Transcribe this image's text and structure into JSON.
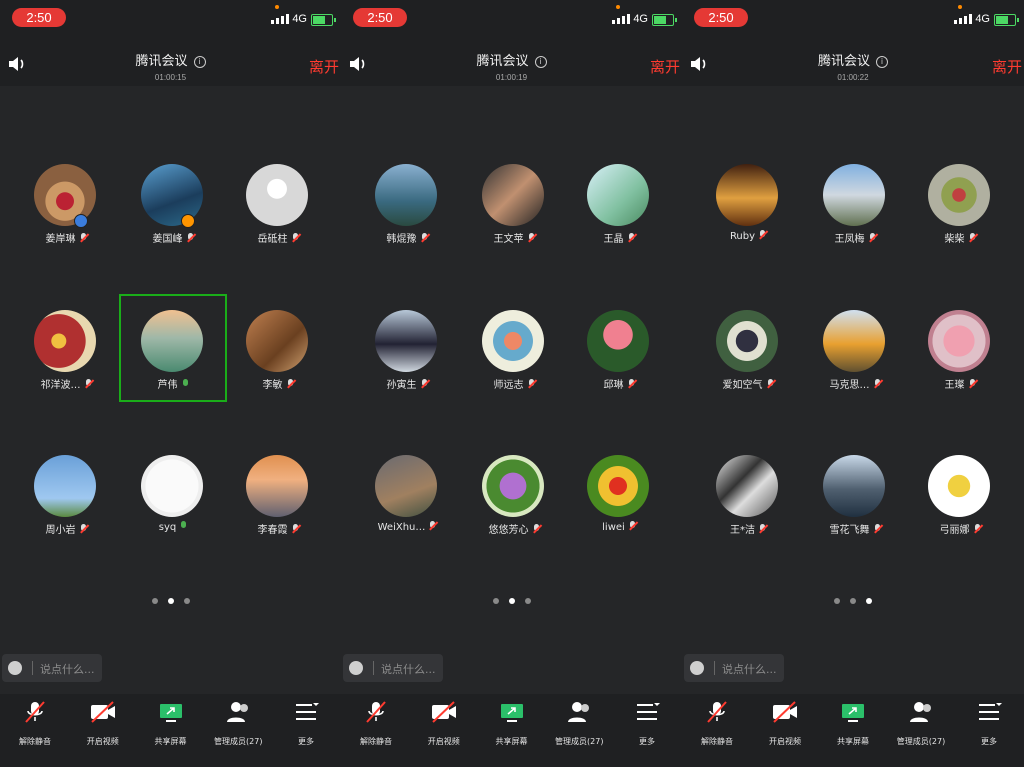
{
  "colors": {
    "accent_red": "#ff3b30",
    "active_green": "#1aad19",
    "bg": "#252628"
  },
  "panels": [
    {
      "status": {
        "time": "2:50",
        "network": "4G"
      },
      "header": {
        "title": "腾讯会议",
        "timer": "01:00:15",
        "leave": "离开"
      },
      "participants": [
        {
          "name": "姜岸琳",
          "mic": "muted"
        },
        {
          "name": "姜国峰",
          "mic": "muted"
        },
        {
          "name": "岳砥柱",
          "mic": "muted"
        },
        {
          "name": "祁洋波…",
          "mic": "muted"
        },
        {
          "name": "芦伟",
          "mic": "active"
        },
        {
          "name": "李敏",
          "mic": "muted"
        },
        {
          "name": "周小岩",
          "mic": "muted"
        },
        {
          "name": "syq",
          "mic": "active"
        },
        {
          "name": "李春霞",
          "mic": "muted"
        }
      ],
      "page_indicator": {
        "total": 3,
        "current": 2
      },
      "chat_placeholder": "说点什么...",
      "toolbar": {
        "unmute": "解除静音",
        "video": "开启视频",
        "share": "共享屏幕",
        "members": "管理成员(27)",
        "more": "更多"
      }
    },
    {
      "status": {
        "time": "2:50",
        "network": "4G"
      },
      "header": {
        "title": "腾讯会议",
        "timer": "01:00:19",
        "leave": "离开"
      },
      "participants": [
        {
          "name": "韩焜豫",
          "mic": "muted"
        },
        {
          "name": "王文苹",
          "mic": "muted"
        },
        {
          "name": "王晶",
          "mic": "muted"
        },
        {
          "name": "孙寅生",
          "mic": "muted"
        },
        {
          "name": "师远志",
          "mic": "muted"
        },
        {
          "name": "邱琳",
          "mic": "muted"
        },
        {
          "name": "WeiXhu…",
          "mic": "muted"
        },
        {
          "name": "悠悠芳心",
          "mic": "muted"
        },
        {
          "name": "liwei",
          "mic": "muted"
        }
      ],
      "page_indicator": {
        "total": 3,
        "current": 2
      },
      "chat_placeholder": "说点什么...",
      "toolbar": {
        "unmute": "解除静音",
        "video": "开启视频",
        "share": "共享屏幕",
        "members": "管理成员(27)",
        "more": "更多"
      }
    },
    {
      "status": {
        "time": "2:50",
        "network": "4G"
      },
      "header": {
        "title": "腾讯会议",
        "timer": "01:00:22",
        "leave": "离开"
      },
      "participants": [
        {
          "name": "Ruby",
          "mic": "muted"
        },
        {
          "name": "王凤梅",
          "mic": "muted"
        },
        {
          "name": "柴柴",
          "mic": "muted"
        },
        {
          "name": "爱如空气",
          "mic": "muted"
        },
        {
          "name": "马克思…",
          "mic": "muted"
        },
        {
          "name": "王璨",
          "mic": "muted"
        },
        {
          "name": "王*洁",
          "mic": "muted"
        },
        {
          "name": "雪花飞舞",
          "mic": "muted"
        },
        {
          "name": "弓丽娜",
          "mic": "muted"
        }
      ],
      "page_indicator": {
        "total": 3,
        "current": 3
      },
      "chat_placeholder": "说点什么...",
      "toolbar": {
        "unmute": "解除静音",
        "video": "开启视频",
        "share": "共享屏幕",
        "members": "管理成员(27)",
        "more": "更多"
      }
    }
  ]
}
